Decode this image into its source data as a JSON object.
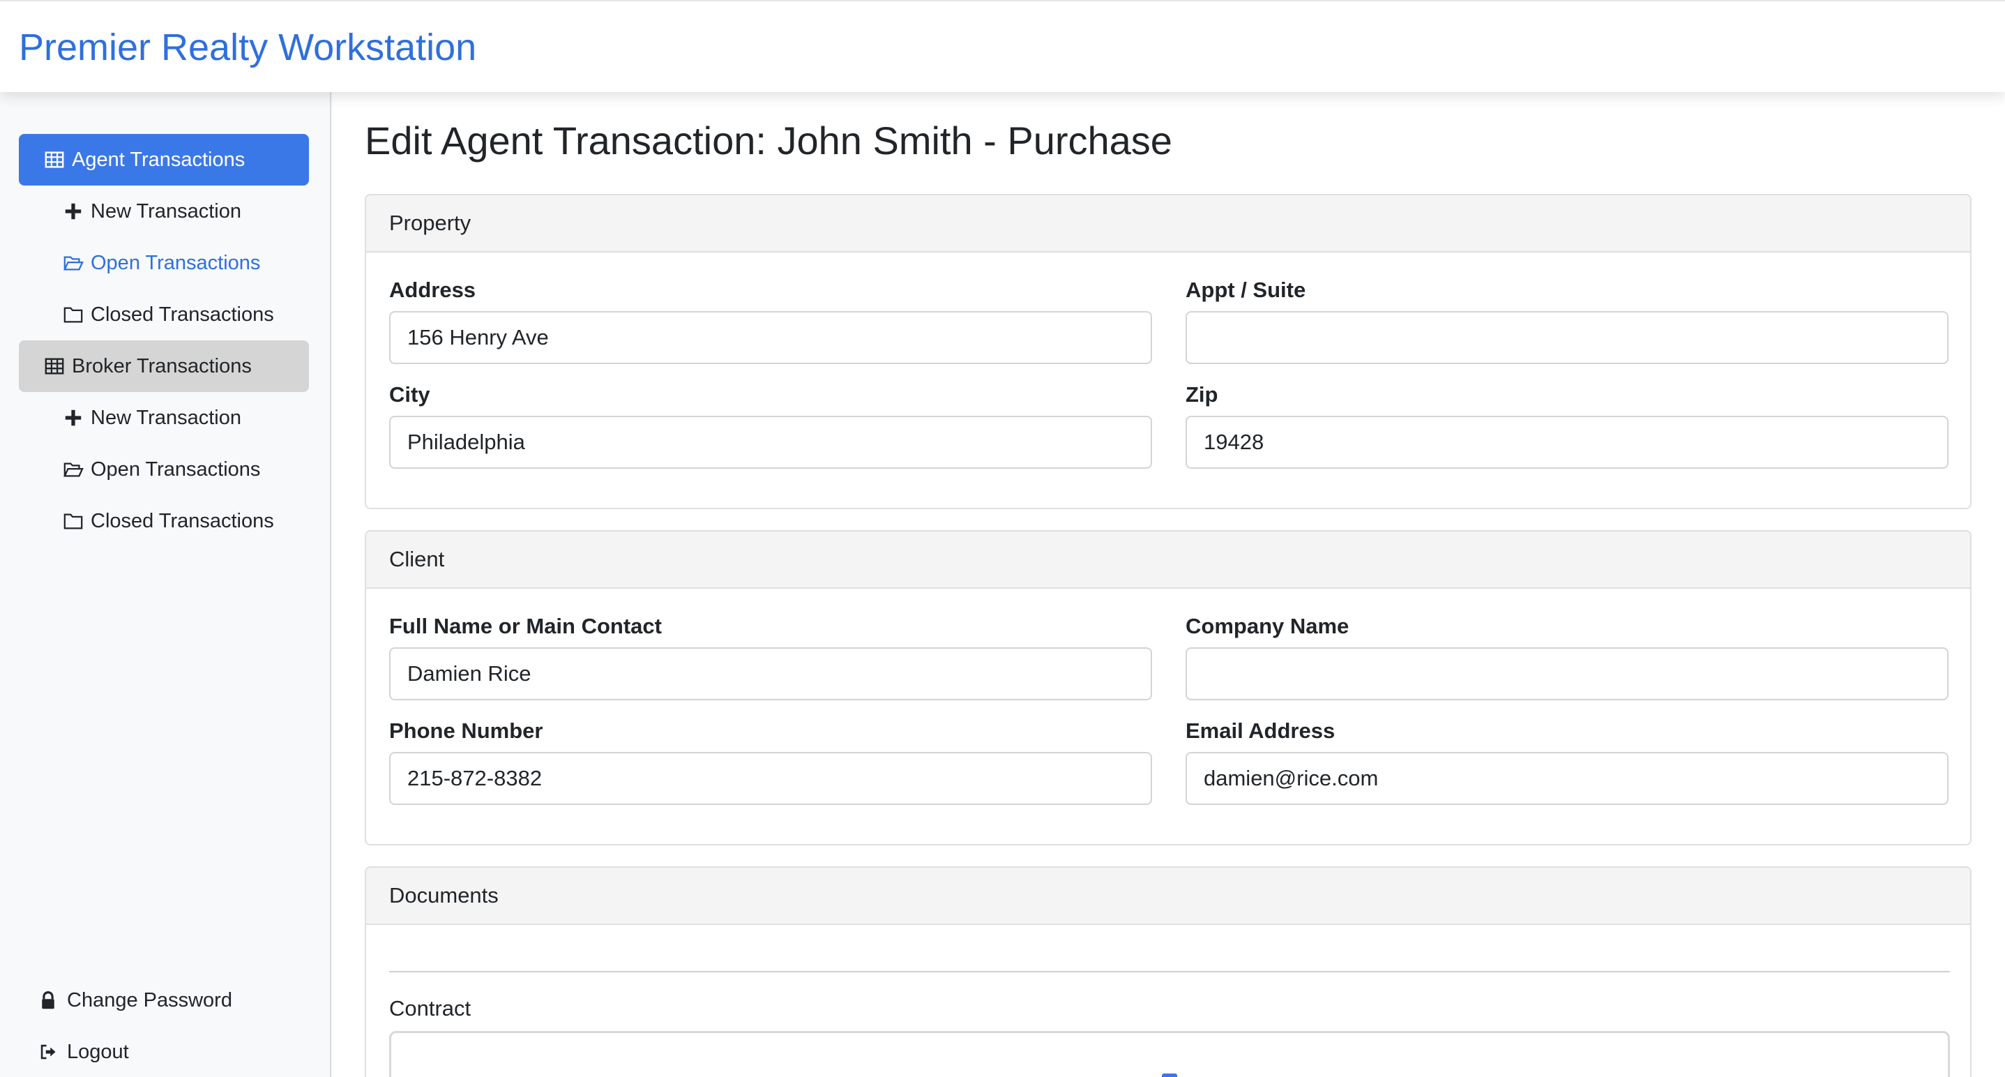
{
  "app": {
    "brand": "Premier Realty Workstation",
    "accent_color": "#3b78e7",
    "link_color": "#2f6fde"
  },
  "sidebar": {
    "items": [
      {
        "label": "Agent Transactions",
        "icon": "table-icon"
      },
      {
        "label": "New Transaction",
        "icon": "plus-icon"
      },
      {
        "label": "Open Transactions",
        "icon": "folder-open-icon"
      },
      {
        "label": "Closed Transactions",
        "icon": "folder-icon"
      },
      {
        "label": "Broker Transactions",
        "icon": "table-icon"
      },
      {
        "label": "New Transaction",
        "icon": "plus-icon"
      },
      {
        "label": "Open Transactions",
        "icon": "folder-open-icon"
      },
      {
        "label": "Closed Transactions",
        "icon": "folder-icon"
      }
    ],
    "bottom": [
      {
        "label": "Change Password",
        "icon": "lock-icon"
      },
      {
        "label": "Logout",
        "icon": "logout-icon"
      }
    ]
  },
  "main": {
    "title": "Edit Agent Transaction: John Smith - Purchase",
    "property": {
      "header": "Property",
      "address_label": "Address",
      "address_value": "156 Henry Ave",
      "suite_label": "Appt / Suite",
      "suite_value": "",
      "city_label": "City",
      "city_value": "Philadelphia",
      "zip_label": "Zip",
      "zip_value": "19428"
    },
    "client": {
      "header": "Client",
      "name_label": "Full Name or Main Contact",
      "name_value": "Damien Rice",
      "company_label": "Company Name",
      "company_value": "",
      "phone_label": "Phone Number",
      "phone_value": "215-872-8382",
      "email_label": "Email Address",
      "email_value": "damien@rice.com"
    },
    "documents": {
      "header": "Documents",
      "contract_label": "Contract"
    }
  }
}
